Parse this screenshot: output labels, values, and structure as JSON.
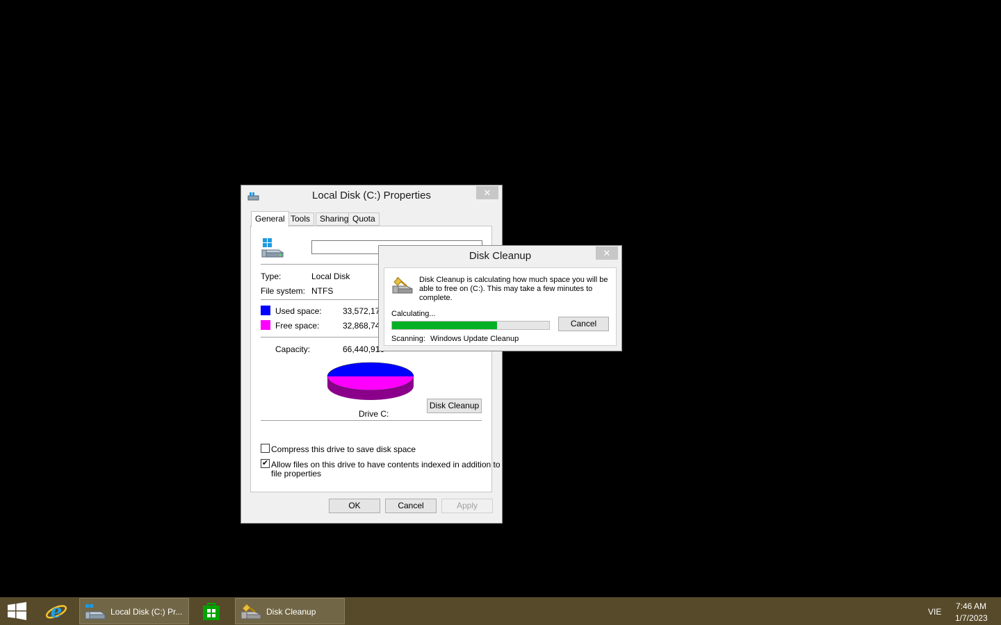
{
  "properties": {
    "title": "Local Disk (C:) Properties",
    "tabs": [
      "General",
      "Tools",
      "Sharing",
      "Quota"
    ],
    "name_value": "",
    "type_label": "Type:",
    "type_value": "Local Disk",
    "fs_label": "File system:",
    "fs_value": "NTFS",
    "used_label": "Used space:",
    "used_value": "33,572,171",
    "free_label": "Free space:",
    "free_value": "32,868,745",
    "capacity_label": "Capacity:",
    "capacity_value": "66,440,916",
    "drive_label": "Drive C:",
    "disk_cleanup_btn": "Disk Cleanup",
    "compress_label": "Compress this drive to save disk space",
    "compress_checked": false,
    "index_label_1": "Allow files on this drive to have contents indexed in addition to",
    "index_label_2": "file properties",
    "index_checked": true,
    "ok_btn": "OK",
    "cancel_btn": "Cancel",
    "apply_btn": "Apply",
    "used_color": "#0000ff",
    "free_color": "#ff00ff"
  },
  "cleanup": {
    "title": "Disk Cleanup",
    "message_1": "Disk Cleanup is calculating how much space you will be",
    "message_2": "able to free on  (C:). This may take a few minutes to",
    "message_3": "complete.",
    "calculating": "Calculating...",
    "progress": 0.67,
    "cancel_btn": "Cancel",
    "scanning_label": "Scanning:",
    "scanning_value": "Windows Update Cleanup"
  },
  "taskbar": {
    "items": [
      {
        "label": "Local Disk (C:) Pr...",
        "icon": "drive-icon"
      },
      {
        "label": "Disk Cleanup",
        "icon": "disk-cleanup-icon"
      }
    ],
    "language": "VIE",
    "time": "7:46 AM",
    "date": "1/7/2023"
  }
}
